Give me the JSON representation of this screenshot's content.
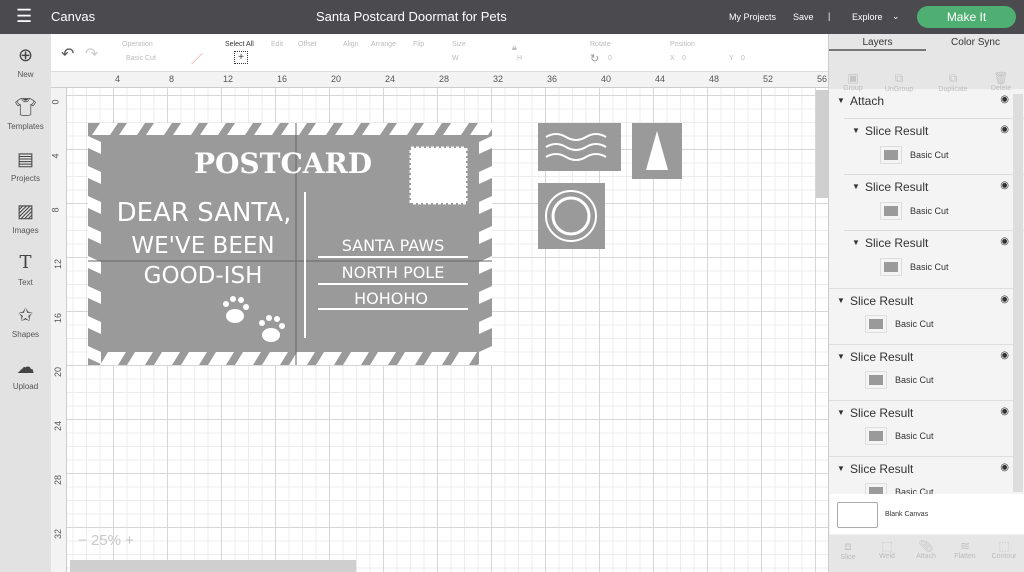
{
  "topbar": {
    "menu_icon": "hamburger-icon",
    "section": "Canvas",
    "title": "Santa Postcard Doormat for Pets",
    "my_projects": "My Projects",
    "save": "Save",
    "divider": "|",
    "explore": "Explore",
    "make_it": "Make It",
    "accent": "#4fae72"
  },
  "leftnav": [
    {
      "label": "New",
      "icon": "plus-circle-icon"
    },
    {
      "label": "Templates",
      "icon": "tshirt-icon"
    },
    {
      "label": "Projects",
      "icon": "notebook-icon"
    },
    {
      "label": "Images",
      "icon": "image-icon"
    },
    {
      "label": "Text",
      "icon": "text-icon"
    },
    {
      "label": "Shapes",
      "icon": "shapes-icon"
    },
    {
      "label": "Upload",
      "icon": "cloud-upload-icon"
    }
  ],
  "toolbar": {
    "operation_label": "Operation",
    "operation_value": "Basic Cut",
    "select_all": "Select All",
    "edit": "Edit",
    "offset": "Offset",
    "align": "Align",
    "arrange": "Arrange",
    "flip": "Flip",
    "size": "Size",
    "w": "W",
    "h": "H",
    "rotate": "Rotate",
    "rotate_value": "0",
    "position": "Position",
    "x": "X",
    "x_value": "0",
    "y": "Y",
    "y_value": "0"
  },
  "ruler": {
    "top": [
      "4",
      "8",
      "12",
      "16",
      "20",
      "24",
      "28",
      "32",
      "36",
      "40",
      "44",
      "48",
      "52",
      "56"
    ],
    "left": [
      "0",
      "4",
      "8",
      "12",
      "16",
      "20",
      "24",
      "28",
      "32"
    ]
  },
  "zoom": {
    "level": "25%",
    "minus": "−",
    "plus": "+"
  },
  "postcard": {
    "title": "POSTCARD",
    "lines": [
      "DEAR SANTA,",
      "WE'VE BEEN",
      "GOOD-ISH"
    ],
    "address": [
      "SANTA PAWS",
      "NORTH POLE",
      "HOHOHO"
    ]
  },
  "panel": {
    "tabs": [
      "Layers",
      "Color Sync"
    ],
    "tools": [
      "Group",
      "UnGroup",
      "Duplicate",
      "Delete"
    ],
    "attach": "Attach",
    "layers": [
      {
        "name": "Slice Result",
        "sub": "Basic Cut"
      },
      {
        "name": "Slice Result",
        "sub": "Basic Cut"
      },
      {
        "name": "Slice Result",
        "sub": "Basic Cut"
      },
      {
        "name": "Slice Result",
        "sub": "Basic Cut"
      },
      {
        "name": "Slice Result",
        "sub": "Basic Cut"
      },
      {
        "name": "Slice Result",
        "sub": "Basic Cut"
      },
      {
        "name": "Slice Result",
        "sub": "Basic Cut"
      }
    ],
    "blank_canvas": "Blank Canvas",
    "bottom_tools": [
      "Slice",
      "Weld",
      "Attach",
      "Flatten",
      "Contour"
    ]
  }
}
